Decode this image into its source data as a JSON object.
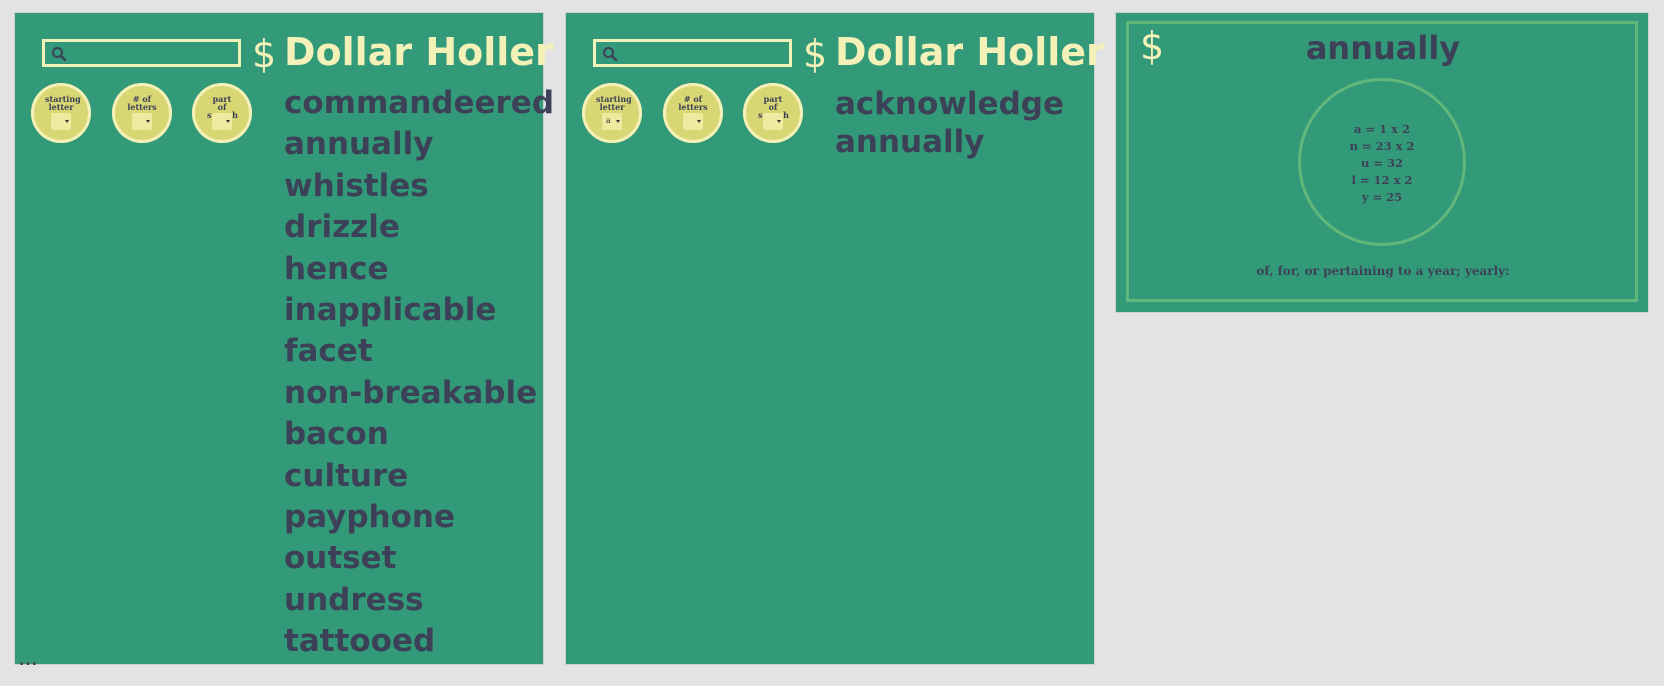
{
  "app": {
    "title": "Dollar Holler",
    "dollar_symbol": "$"
  },
  "panels": [
    {
      "search": {
        "value": "",
        "placeholder": ""
      },
      "filters": [
        {
          "label": "starting letter",
          "selected": ""
        },
        {
          "label": "# of letters",
          "selected": ""
        },
        {
          "label": "part of speech",
          "selected": ""
        }
      ],
      "words": [
        "commandeered",
        "annually",
        "whistles",
        "drizzle",
        "hence",
        "inapplicable",
        "facet",
        "non-breakable",
        "bacon",
        "culture",
        "payphone",
        "outset",
        "undress",
        "tattooed"
      ],
      "more_indicator": "..."
    },
    {
      "search": {
        "value": "",
        "placeholder": ""
      },
      "filters": [
        {
          "label": "starting letter",
          "selected": "a"
        },
        {
          "label": "# of letters",
          "selected": ""
        },
        {
          "label": "part of speech",
          "selected": ""
        }
      ],
      "words": [
        "acknowledge",
        "annually"
      ]
    }
  ],
  "detail": {
    "dollar_symbol": "$",
    "word": "annually",
    "score_lines": [
      "a = 1 x 2",
      "n = 23 x 2",
      "u = 32",
      "l = 12 x 2",
      "y = 25"
    ],
    "definition": "of, for, or pertaining to a year; yearly:"
  },
  "colors": {
    "panel_bg": "#329a78",
    "accent": "#f3f0b8",
    "text": "#3c4158",
    "filter_bg": "#d9d774",
    "card_border": "#62b77a"
  },
  "icons": {
    "search": "search-icon",
    "dropdown": "chevron-down-icon",
    "dollar": "dollar-sign"
  }
}
